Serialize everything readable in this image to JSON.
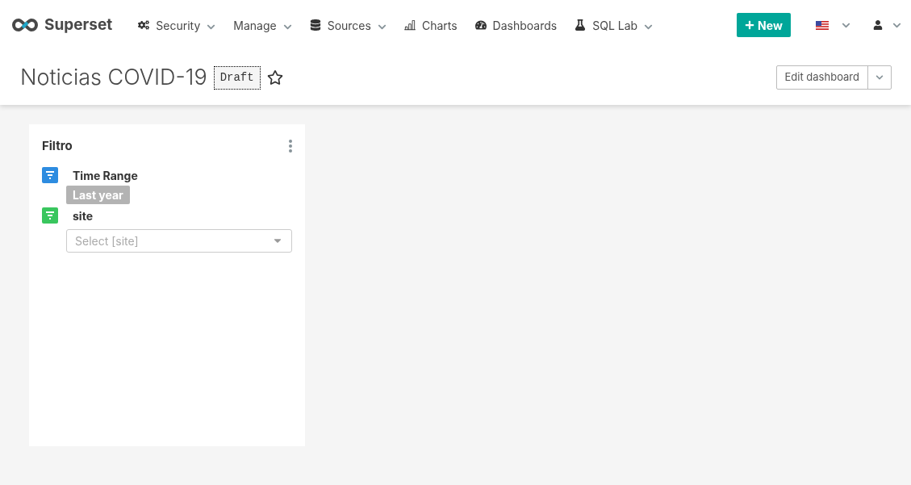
{
  "brand": {
    "name": "Superset"
  },
  "nav": [
    {
      "label": "Security",
      "dropdown": true
    },
    {
      "label": "Manage",
      "dropdown": true
    },
    {
      "label": "Sources",
      "dropdown": true
    },
    {
      "label": "Charts",
      "dropdown": false
    },
    {
      "label": "Dashboards",
      "dropdown": false
    },
    {
      "label": "SQL Lab",
      "dropdown": true
    }
  ],
  "new_button": {
    "label": "New"
  },
  "dashboard": {
    "title": "Noticias COVID-19",
    "status": "Draft",
    "starred": false,
    "edit_button": "Edit dashboard"
  },
  "filter_box": {
    "title": "Filtro",
    "filters": [
      {
        "name": "Time Range",
        "color": "#2d8ce0",
        "kind": "tag",
        "value": "Last year"
      },
      {
        "name": "site",
        "color": "#39c65e",
        "kind": "select",
        "placeholder": "Select [site]"
      }
    ]
  }
}
